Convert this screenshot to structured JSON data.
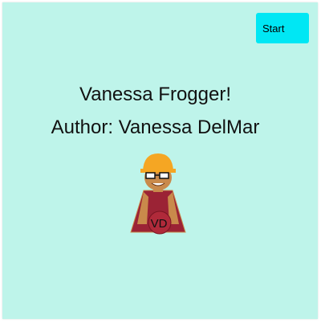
{
  "start_button": {
    "label": "Start"
  },
  "title": "Vanessa Frogger!",
  "author": "Author: Vanessa DelMar",
  "avatar": {
    "initials": "VD"
  },
  "colors": {
    "background": "#bef4ea",
    "button": "#00e7f4",
    "hat": "#f5a623",
    "skin": "#c98a4b",
    "shirt": "#9b2335",
    "ball": "#b02a3a"
  }
}
